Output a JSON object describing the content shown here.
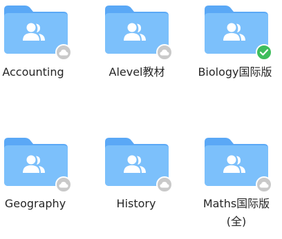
{
  "folders": [
    {
      "name": "Accounting",
      "status_icon": "cloud-icon",
      "icon": "shared-folder-icon"
    },
    {
      "name": "Alevel教材",
      "status_icon": "cloud-icon",
      "icon": "shared-folder-icon"
    },
    {
      "name": "Biology国际版",
      "status_icon": "synced-check-icon",
      "icon": "shared-folder-icon"
    },
    {
      "name": "Geography",
      "status_icon": "cloud-icon",
      "icon": "shared-folder-icon"
    },
    {
      "name": "History",
      "status_icon": "cloud-icon",
      "icon": "shared-folder-icon"
    },
    {
      "name_line1": "Maths国际版",
      "name_line2": "(全)",
      "status_icon": "cloud-icon",
      "icon": "shared-folder-icon"
    }
  ],
  "colors": {
    "folder_back": "#5aa8f6",
    "folder_front": "#7cc0fb",
    "people": "#ffffff",
    "cloud_badge": "#c9c9c9",
    "synced_badge": "#3ebd5c",
    "label_text": "#262626"
  }
}
